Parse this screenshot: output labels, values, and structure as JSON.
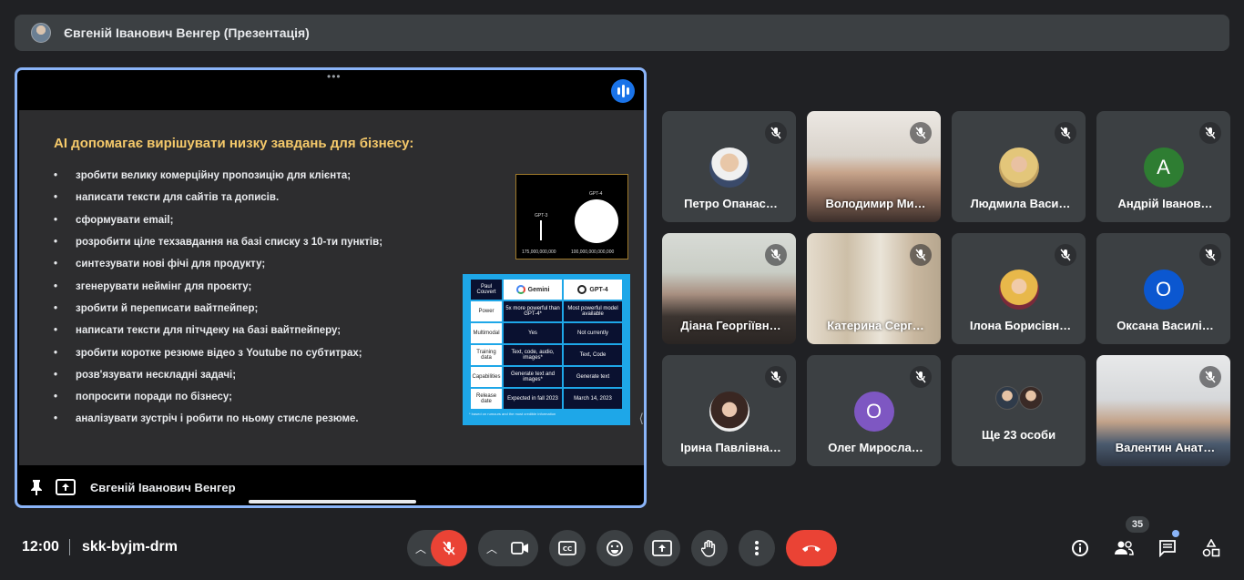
{
  "presenter_bar": {
    "title": "Євгеній Іванович Венгер (Презентація)"
  },
  "presentation": {
    "presenter_name": "Євгеній Іванович Венгер",
    "slide": {
      "title": "AI допомагає вирішувати низку завдань для бізнесу:",
      "bullets": [
        "зробити велику комерційну пропозицію для клієнта;",
        "написати тексти для сайтів та дописів.",
        "сформувати email;",
        "розробити ціле техзавдання на базі списку з 10-ти пунктів;",
        "синтезувати нові фічі для продукту;",
        "згенерувати неймінг для проєкту;",
        "зробити й переписати вайтпейпер;",
        "написати тексти для пітчдеку на базі вайтпейперу;",
        "зробити коротке резюме відео з Youtube по субтитрах;",
        "розв'язувати нескладні задачі;",
        "попросити поради по бізнесу;",
        "аналізувати зустріч і робити по ньому стисле резюме."
      ],
      "gpt_chart": {
        "label_small": "GPT-3",
        "label_big": "GPT-4",
        "value_small": "175,000,000,000",
        "value_big": "100,000,000,000,000"
      },
      "comparison": {
        "corner": "Paul Couvert",
        "col1": "Gemini",
        "col2": "GPT-4",
        "rows": [
          {
            "label": "Power",
            "c1": "5x more powerful than GPT-4*",
            "c2": "Most powerful model available"
          },
          {
            "label": "Multimodal",
            "c1": "Yes",
            "c2": "Not currently"
          },
          {
            "label": "Training data",
            "c1": "Text, code, audio, images*",
            "c2": "Text, Code"
          },
          {
            "label": "Capabilities",
            "c1": "Generate text and images*",
            "c2": "Generate text"
          },
          {
            "label": "Release date",
            "c1": "Expected in fall 2023",
            "c2": "March 14, 2023"
          }
        ],
        "footnote": "* based on rumours and the most credible information"
      }
    }
  },
  "participants": [
    {
      "name": "Петро Опанас…",
      "avatar": "photo",
      "muted": true
    },
    {
      "name": "Володимир Ми…",
      "avatar": "video",
      "muted": true
    },
    {
      "name": "Людмила Васи…",
      "avatar": "photo",
      "muted": true
    },
    {
      "name": "Андрій Іванов…",
      "avatar": "letter",
      "letter": "А",
      "color": "#2e7d32",
      "muted": true
    },
    {
      "name": "Діана Георгіївн…",
      "avatar": "video",
      "muted": true
    },
    {
      "name": "Катерина Серг…",
      "avatar": "video",
      "muted": true
    },
    {
      "name": "Ілона Борисівн…",
      "avatar": "photo",
      "muted": true
    },
    {
      "name": "Оксана Василі…",
      "avatar": "letter",
      "letter": "О",
      "color": "#0b57d0",
      "muted": true
    },
    {
      "name": "Ірина Павлівна…",
      "avatar": "photo",
      "muted": true
    },
    {
      "name": "Олег Миросла…",
      "avatar": "letter",
      "letter": "О",
      "color": "#7e57c2",
      "muted": true
    },
    {
      "name": "Ще 23 особи",
      "avatar": "group",
      "muted": false
    },
    {
      "name": "Валентин Анат…",
      "avatar": "video",
      "muted": true
    }
  ],
  "controls": {
    "time": "12:00",
    "meeting_code": "skk-byjm-drm",
    "participants_count": "35",
    "colors": {
      "end_call": "#ea4335",
      "mic_off": "#ea4335",
      "bar": "#3c4043"
    }
  }
}
